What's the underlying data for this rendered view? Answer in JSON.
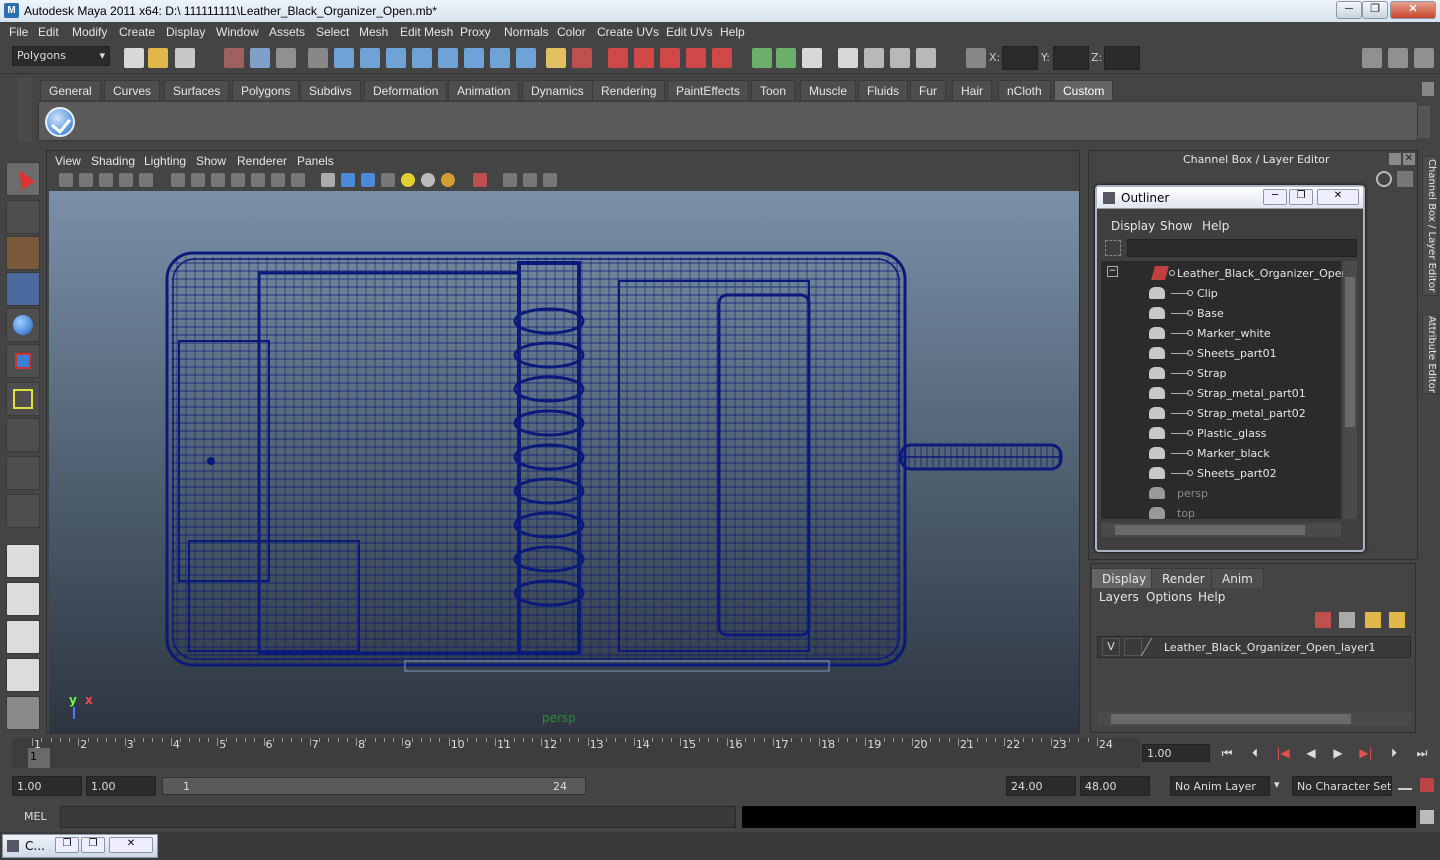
{
  "window": {
    "title": "Autodesk Maya 2011 x64: D:\\ 111111111\\Leather_Black_Organizer_Open.mb*",
    "minimize": "─",
    "restore": "❐",
    "close": "✕"
  },
  "menubar": [
    "File",
    "Edit",
    "Modify",
    "Create",
    "Display",
    "Window",
    "Assets",
    "Select",
    "Mesh",
    "Edit Mesh",
    "Proxy",
    "Normals",
    "Color",
    "Create UVs",
    "Edit UVs",
    "Help"
  ],
  "statusline": {
    "mode": "Polygons",
    "x_label": "X:",
    "y_label": "Y:",
    "z_label": "Z:"
  },
  "shelf": {
    "tabs": [
      "General",
      "Curves",
      "Surfaces",
      "Polygons",
      "Subdivs",
      "Deformation",
      "Animation",
      "Dynamics",
      "Rendering",
      "PaintEffects",
      "Toon",
      "Muscle",
      "Fluids",
      "Fur",
      "Hair",
      "nCloth",
      "Custom"
    ],
    "active_tab": "Custom"
  },
  "viewport": {
    "menus": [
      "View",
      "Shading",
      "Lighting",
      "Show",
      "Renderer",
      "Panels"
    ],
    "camera_label": "persp",
    "axis_y": "y",
    "axis_x": "x",
    "wire_color": "#0a1a7a"
  },
  "channel_box": {
    "title": "Channel Box / Layer Editor"
  },
  "outliner": {
    "title": "Outliner",
    "menus": [
      "Display",
      "Show",
      "Help"
    ],
    "root": "Leather_Black_Organizer_Open",
    "collapse": "−",
    "children": [
      "Clip",
      "Base",
      "Marker_white",
      "Sheets_part01",
      "Strap",
      "Strap_metal_part01",
      "Strap_metal_part02",
      "Plastic_glass",
      "Marker_black",
      "Sheets_part02"
    ],
    "cameras": [
      "persp",
      "top"
    ]
  },
  "layer_editor": {
    "tabs": [
      "Display",
      "Render",
      "Anim"
    ],
    "active_tab": "Display",
    "menus": [
      "Layers",
      "Options",
      "Help"
    ],
    "layer": {
      "visible": "V",
      "name": "Leather_Black_Organizer_Open_layer1"
    }
  },
  "side_tabs": [
    "Channel Box / Layer Editor",
    "Attribute Editor"
  ],
  "timeline": {
    "ticks": [
      "1",
      "2",
      "3",
      "4",
      "5",
      "6",
      "7",
      "8",
      "9",
      "10",
      "11",
      "12",
      "13",
      "14",
      "15",
      "16",
      "17",
      "18",
      "19",
      "20",
      "21",
      "22",
      "23",
      "24"
    ],
    "current_frame_marker": "1",
    "current_frame": "1.00",
    "playback_buttons": [
      "⏮",
      "⏴",
      "|◀",
      "◀",
      "▶",
      "▶|",
      "⏵",
      "⏭"
    ]
  },
  "range": {
    "start": "1.00",
    "playback_start": "1.00",
    "slider_start": "1",
    "slider_end": "24",
    "playback_end": "24.00",
    "end": "48.00",
    "anim_layer": "No Anim Layer",
    "character_set": "No Character Set"
  },
  "command_line": {
    "label": "MEL"
  },
  "minimized_window": {
    "label": "C..."
  }
}
